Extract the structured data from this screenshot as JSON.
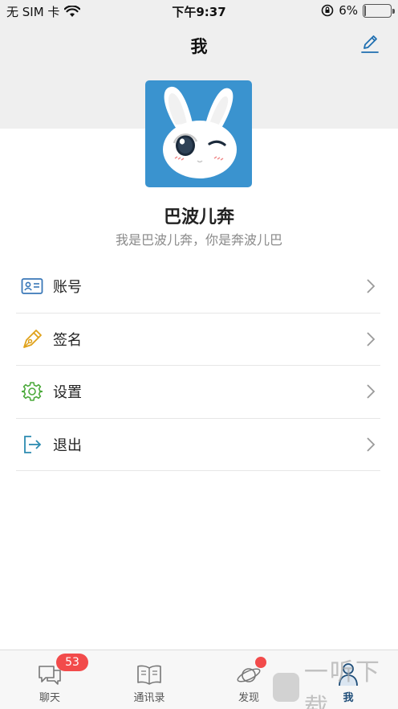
{
  "status_bar": {
    "carrier": "无 SIM 卡",
    "time": "下午9:37",
    "battery": "6%",
    "battery_level": 0.06
  },
  "nav": {
    "title": "我",
    "edit_icon": "edit-pencil-icon"
  },
  "profile": {
    "avatar": "rabbit-avatar",
    "name": "巴波儿奔",
    "signature": "我是巴波儿奔，你是奔波儿巴"
  },
  "menu": {
    "items": [
      {
        "label": "账号",
        "icon": "id-card-icon",
        "color": "#3a78b8"
      },
      {
        "label": "签名",
        "icon": "pen-nib-icon",
        "color": "#e0a21b"
      },
      {
        "label": "设置",
        "icon": "gear-icon",
        "color": "#4caa3c"
      },
      {
        "label": "退出",
        "icon": "logout-icon",
        "color": "#2c8bb0"
      }
    ]
  },
  "tabs": {
    "items": [
      {
        "label": "聊天",
        "badge": "53"
      },
      {
        "label": "通讯录"
      },
      {
        "label": "发现",
        "dot": true
      },
      {
        "label": "我",
        "active": true
      }
    ]
  },
  "watermark": {
    "text": "一听下载"
  },
  "colors": {
    "accent": "#1f4e79",
    "badge": "#f24b4b",
    "avatar_bg": "#3a93cf"
  }
}
